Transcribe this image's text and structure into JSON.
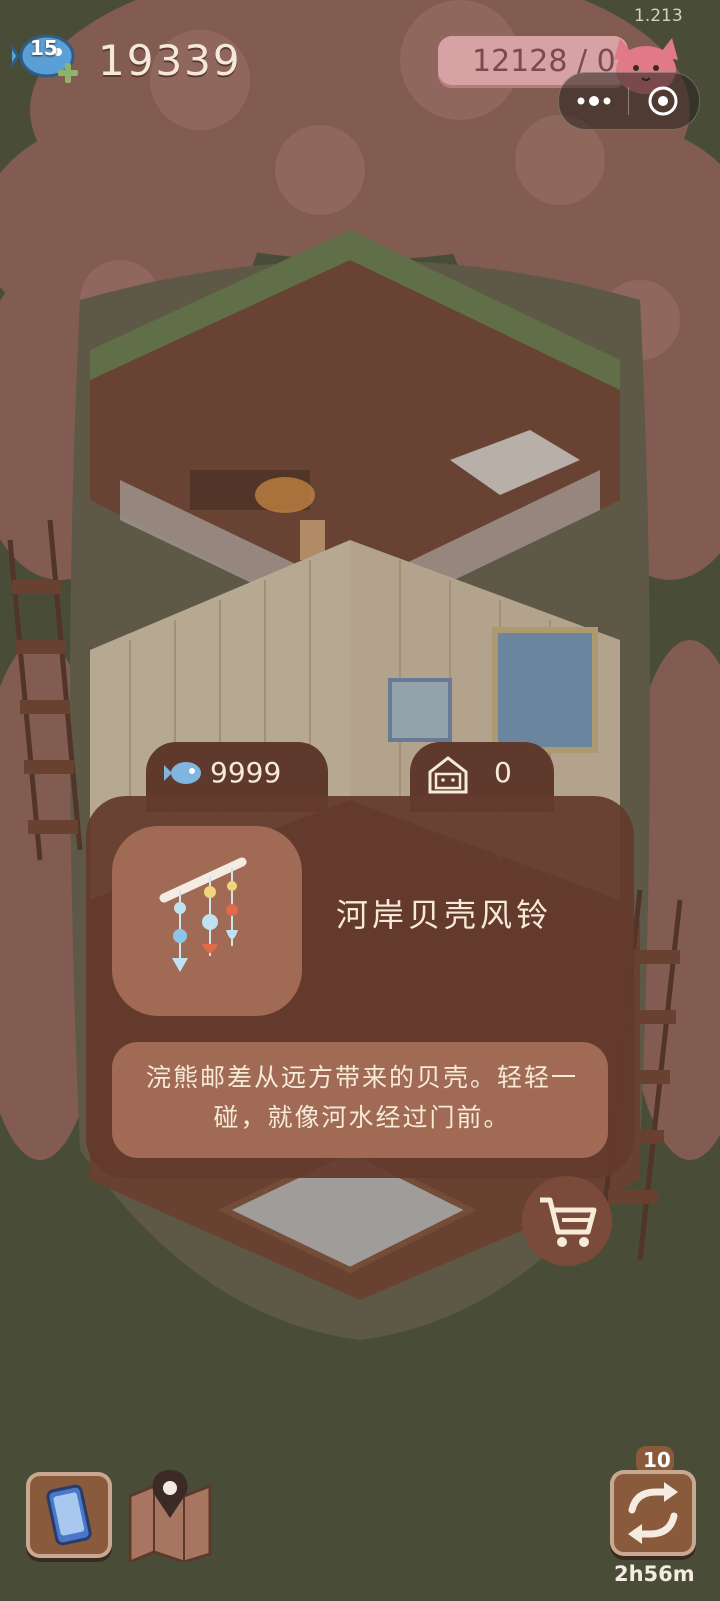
{
  "hud": {
    "level": "15",
    "coins": "19339",
    "version": "1.213",
    "exp_text": "12128 / 0"
  },
  "popup": {
    "currency_count": "9999",
    "owned_count": "0",
    "item_name": "河岸贝壳风铃",
    "item_description": "浣熊邮差从远方带来的贝壳。轻轻一碰，就像河水经过门前。",
    "cart_icon": "cart-icon"
  },
  "bottom": {
    "refresh_count": "10",
    "timer": "2h56m"
  },
  "colors": {
    "panel": "#643a2c",
    "accent": "#a06a55",
    "text": "#f6ead8"
  }
}
